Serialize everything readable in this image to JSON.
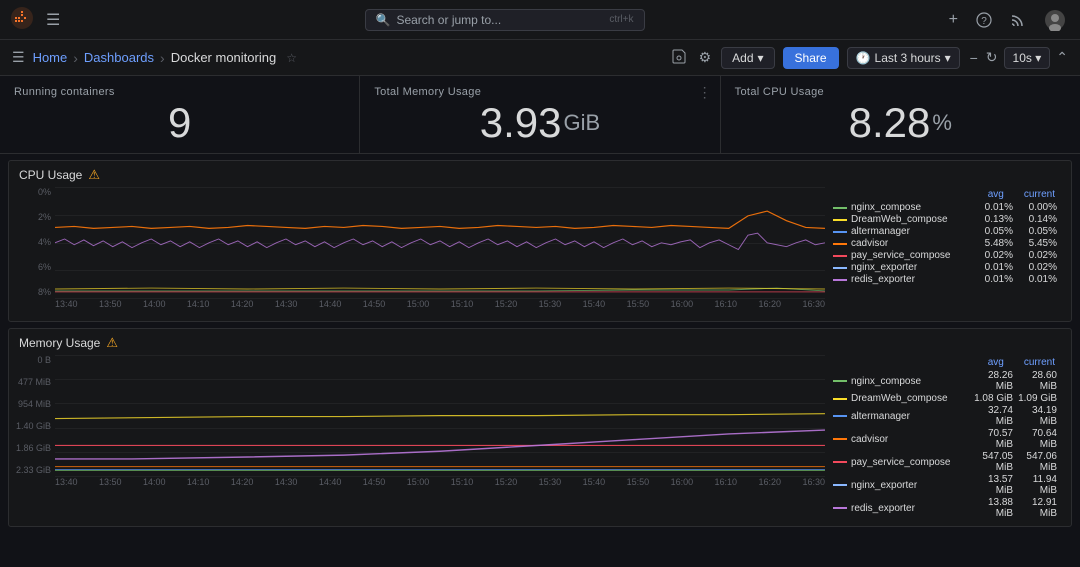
{
  "app": {
    "logo_color": "#f6732a"
  },
  "topnav": {
    "search_placeholder": "Search or jump to...",
    "shortcut": "ctrl+k",
    "plus_label": "+",
    "help_icon": "?",
    "rss_icon": "rss",
    "user_icon": "user"
  },
  "breadcrumb": {
    "home": "Home",
    "dashboards": "Dashboards",
    "current": "Docker monitoring",
    "add_label": "Add",
    "add_caret": "▾",
    "share_label": "Share",
    "time_icon": "🕐",
    "time_range": "Last 3 hours",
    "time_caret": "▾",
    "zoom_out": "−",
    "refresh": "↻",
    "interval": "10s",
    "interval_caret": "▾",
    "collapse": "⌃"
  },
  "stat_cards": [
    {
      "title": "Running containers",
      "value": "9",
      "unit": ""
    },
    {
      "title": "Total Memory Usage",
      "value": "3.93",
      "unit": "GiB",
      "has_more": true
    },
    {
      "title": "Total CPU Usage",
      "value": "8.28",
      "unit": "%"
    }
  ],
  "cpu_panel": {
    "title": "CPU Usage",
    "warn": "⚠",
    "y_labels": [
      "8%",
      "6%",
      "4%",
      "2%",
      "0%"
    ],
    "x_labels": [
      "13:40",
      "13:50",
      "14:00",
      "14:10",
      "14:20",
      "14:30",
      "14:40",
      "14:50",
      "15:00",
      "15:10",
      "15:20",
      "15:30",
      "15:40",
      "15:50",
      "16:00",
      "16:10",
      "16:20",
      "16:30"
    ],
    "legend_header": {
      "avg": "avg",
      "current": "current"
    },
    "legend": [
      {
        "name": "nginx_compose",
        "color": "#73bf69",
        "avg": "0.01%",
        "current": "0.00%"
      },
      {
        "name": "DreamWeb_compose",
        "color": "#fade2a",
        "avg": "0.13%",
        "current": "0.14%"
      },
      {
        "name": "altermanager",
        "color": "#5794f2",
        "avg": "0.05%",
        "current": "0.05%"
      },
      {
        "name": "cadvisor",
        "color": "#ff780a",
        "avg": "5.48%",
        "current": "5.45%"
      },
      {
        "name": "pay_service_compose",
        "color": "#f2495c",
        "avg": "0.02%",
        "current": "0.02%"
      },
      {
        "name": "nginx_exporter",
        "color": "#8ab8ff",
        "avg": "0.01%",
        "current": "0.02%"
      },
      {
        "name": "redis_exporter",
        "color": "#b877d9",
        "avg": "0.01%",
        "current": "0.01%"
      }
    ]
  },
  "memory_panel": {
    "title": "Memory Usage",
    "warn": "⚠",
    "y_labels": [
      "2.33 GiB",
      "1.86 GiB",
      "1.40 GiB",
      "954 MiB",
      "477 MiB",
      "0 B"
    ],
    "x_labels": [
      "13:40",
      "13:50",
      "14:00",
      "14:10",
      "14:20",
      "14:30",
      "14:40",
      "14:50",
      "15:00",
      "15:10",
      "15:20",
      "15:30",
      "15:40",
      "15:50",
      "16:00",
      "16:10",
      "16:20",
      "16:30"
    ],
    "legend_header": {
      "avg": "avg",
      "current": "current"
    },
    "legend": [
      {
        "name": "nginx_compose",
        "color": "#73bf69",
        "avg": "28.26 MiB",
        "current": "28.60 MiB"
      },
      {
        "name": "DreamWeb_compose",
        "color": "#fade2a",
        "avg": "1.08 GiB",
        "current": "1.09 GiB"
      },
      {
        "name": "altermanager",
        "color": "#5794f2",
        "avg": "32.74 MiB",
        "current": "34.19 MiB"
      },
      {
        "name": "cadvisor",
        "color": "#ff780a",
        "avg": "70.57 MiB",
        "current": "70.64 MiB"
      },
      {
        "name": "pay_service_compose",
        "color": "#f2495c",
        "avg": "547.05 MiB",
        "current": "547.06 MiB"
      },
      {
        "name": "nginx_exporter",
        "color": "#8ab8ff",
        "avg": "13.57 MiB",
        "current": "11.94 MiB"
      },
      {
        "name": "redis_exporter",
        "color": "#b877d9",
        "avg": "13.88 MiB",
        "current": "12.91 MiB"
      }
    ]
  }
}
